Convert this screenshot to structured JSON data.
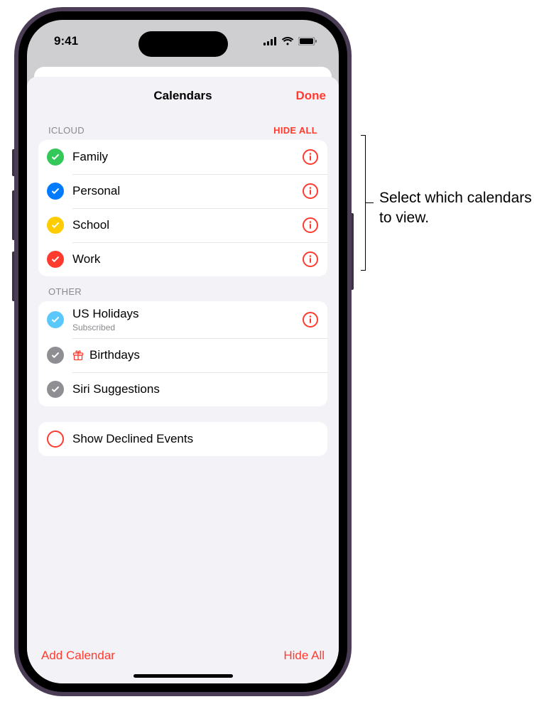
{
  "status": {
    "time": "9:41"
  },
  "sheet": {
    "title": "Calendars",
    "done": "Done"
  },
  "sections": {
    "icloud": {
      "title": "ICLOUD",
      "hide_all": "HIDE ALL",
      "items": [
        {
          "label": "Family",
          "color": "#34c759"
        },
        {
          "label": "Personal",
          "color": "#007aff"
        },
        {
          "label": "School",
          "color": "#ffcc00"
        },
        {
          "label": "Work",
          "color": "#ff3b30"
        }
      ]
    },
    "other": {
      "title": "OTHER",
      "items": [
        {
          "label": "US Holidays",
          "sub": "Subscribed",
          "color": "#5ac8fa",
          "info": true
        },
        {
          "label": "Birthdays",
          "color": "#8e8e93",
          "gift": true
        },
        {
          "label": "Siri Suggestions",
          "color": "#8e8e93"
        }
      ]
    },
    "options": {
      "show_declined": "Show Declined Events"
    }
  },
  "footer": {
    "add": "Add Calendar",
    "hide_all": "Hide All"
  },
  "callout": "Select which calendars to view."
}
